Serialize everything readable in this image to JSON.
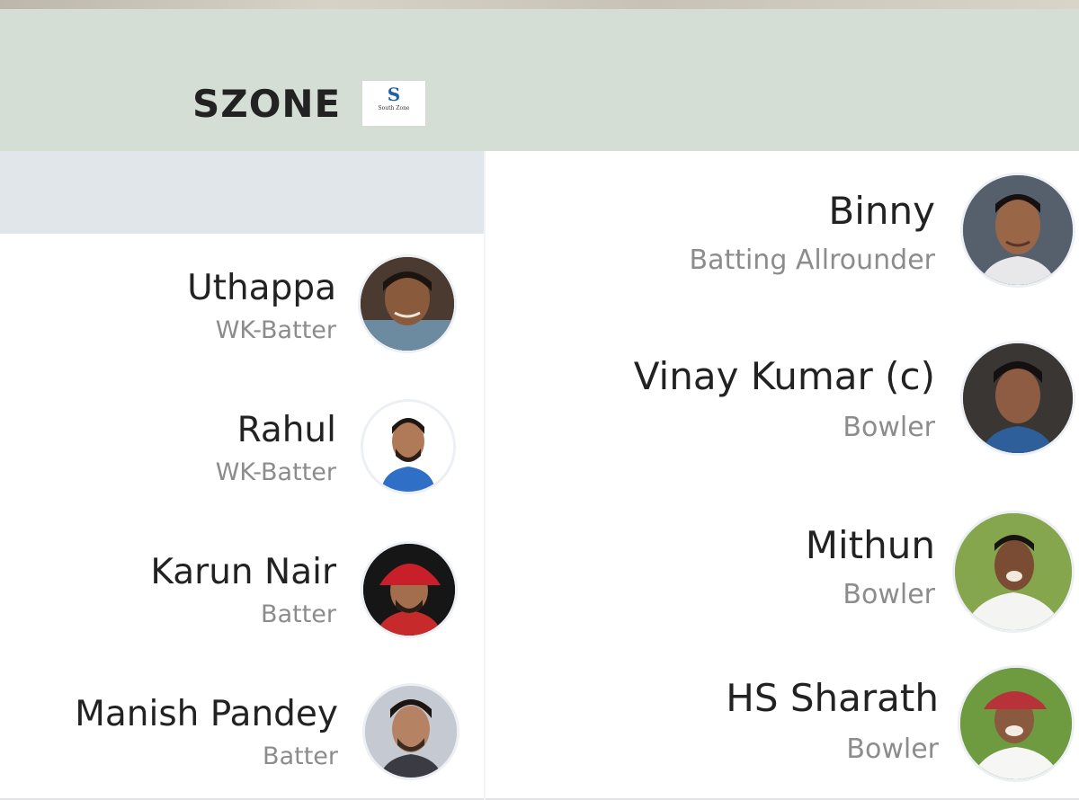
{
  "header": {
    "team_name": "SZONE",
    "logo": {
      "letter": "S",
      "subtitle": "South Zone"
    }
  },
  "players_left": [
    {
      "name": "Uthappa",
      "role": "WK-Batter",
      "avatar": "player-photo"
    },
    {
      "name": "Rahul",
      "role": "WK-Batter",
      "avatar": "player-photo"
    },
    {
      "name": "Karun Nair",
      "role": "Batter",
      "avatar": "player-photo"
    },
    {
      "name": "Manish Pandey",
      "role": "Batter",
      "avatar": "player-photo"
    }
  ],
  "players_right": [
    {
      "name": "Binny",
      "role": "Batting Allrounder",
      "avatar": "player-photo"
    },
    {
      "name": "Vinay Kumar (c)",
      "role": "Bowler",
      "avatar": "player-photo"
    },
    {
      "name": "Mithun",
      "role": "Bowler",
      "avatar": "player-photo"
    },
    {
      "name": "HS Sharath",
      "role": "Bowler",
      "avatar": "player-photo"
    }
  ],
  "colors": {
    "header_bg": "#d4ded5",
    "card_bg": "#ffffff",
    "name_text": "#222222",
    "role_text": "#8c8c8c"
  }
}
